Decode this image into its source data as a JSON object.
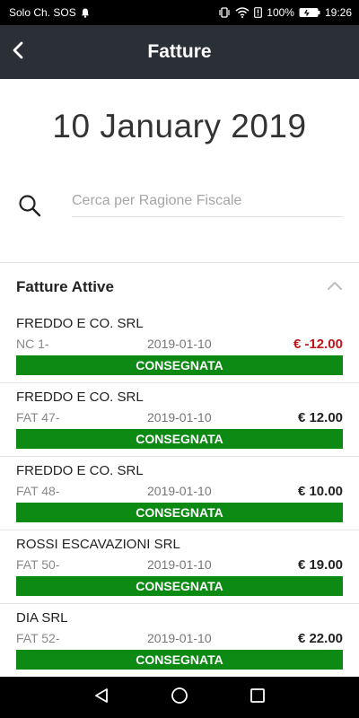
{
  "statusbar": {
    "carrier": "Solo Ch. SOS",
    "battery": "100%",
    "time": "19:26"
  },
  "appbar": {
    "title": "Fatture"
  },
  "date_display": "10 January 2019",
  "search": {
    "placeholder": "Cerca per Ragione Fiscale",
    "value": ""
  },
  "section": {
    "title": "Fatture Attive"
  },
  "invoices": [
    {
      "company": "FREDDO E CO. SRL",
      "number": "NC 1-",
      "date": "2019-01-10",
      "amount": "€ -12.00",
      "status": "CONSEGNATA",
      "negative": true
    },
    {
      "company": "FREDDO E CO. SRL",
      "number": "FAT 47-",
      "date": "2019-01-10",
      "amount": "€ 12.00",
      "status": "CONSEGNATA",
      "negative": false
    },
    {
      "company": "FREDDO E CO. SRL",
      "number": "FAT 48-",
      "date": "2019-01-10",
      "amount": "€ 10.00",
      "status": "CONSEGNATA",
      "negative": false
    },
    {
      "company": "ROSSI ESCAVAZIONI SRL",
      "number": "FAT 50-",
      "date": "2019-01-10",
      "amount": "€ 19.00",
      "status": "CONSEGNATA",
      "negative": false
    },
    {
      "company": "DIA SRL",
      "number": "FAT 52-",
      "date": "2019-01-10",
      "amount": "€ 22.00",
      "status": "CONSEGNATA",
      "negative": false
    }
  ],
  "colors": {
    "appbar_bg": "#2b2f36",
    "status_green": "#0c8a14",
    "negative_red": "#c0141a"
  }
}
